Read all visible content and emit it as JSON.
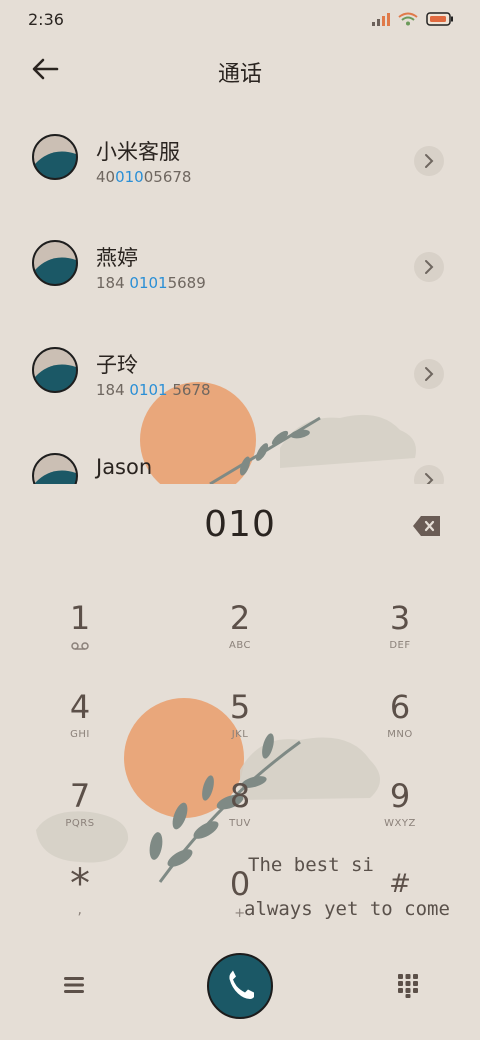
{
  "status_bar": {
    "time": "2:36"
  },
  "header": {
    "title": "通话"
  },
  "contacts": [
    {
      "name": "小米客服",
      "num_pre": "40",
      "num_hl": "010",
      "num_post": "05678"
    },
    {
      "name": "燕婷",
      "num_pre": "184 ",
      "num_hl": "0101",
      "num_post": "5689"
    },
    {
      "name": "子玲",
      "num_pre": "184 ",
      "num_hl": "0101",
      "num_post": " 5678"
    },
    {
      "name": "Jason",
      "num_pre": "",
      "num_hl": "",
      "num_post": ""
    }
  ],
  "dial": {
    "number": "010",
    "keys": [
      {
        "digit": "1",
        "letters": ""
      },
      {
        "digit": "2",
        "letters": "ABC"
      },
      {
        "digit": "3",
        "letters": "DEF"
      },
      {
        "digit": "4",
        "letters": "GHI"
      },
      {
        "digit": "5",
        "letters": "JKL"
      },
      {
        "digit": "6",
        "letters": "MNO"
      },
      {
        "digit": "7",
        "letters": "PQRS"
      },
      {
        "digit": "8",
        "letters": "TUV"
      },
      {
        "digit": "9",
        "letters": "WXYZ"
      },
      {
        "digit": "*",
        "letters": ","
      },
      {
        "digit": "0",
        "letters": "+"
      },
      {
        "digit": "#",
        "letters": ""
      }
    ]
  },
  "wallpaper": {
    "line1": "The best si",
    "line2": "always yet to come"
  },
  "icons": [
    "signal-icon",
    "wifi-icon",
    "battery-icon",
    "back-arrow-icon",
    "chevron-right-icon",
    "backspace-icon",
    "voicemail-icon",
    "menu-icon",
    "phone-icon",
    "dialpad-icon"
  ],
  "colors": {
    "background": "#e5ded6",
    "highlight": "#2a8fd6",
    "call_button": "#1b5866",
    "sun": "#e9a273",
    "leaf": "#7f8a85"
  }
}
